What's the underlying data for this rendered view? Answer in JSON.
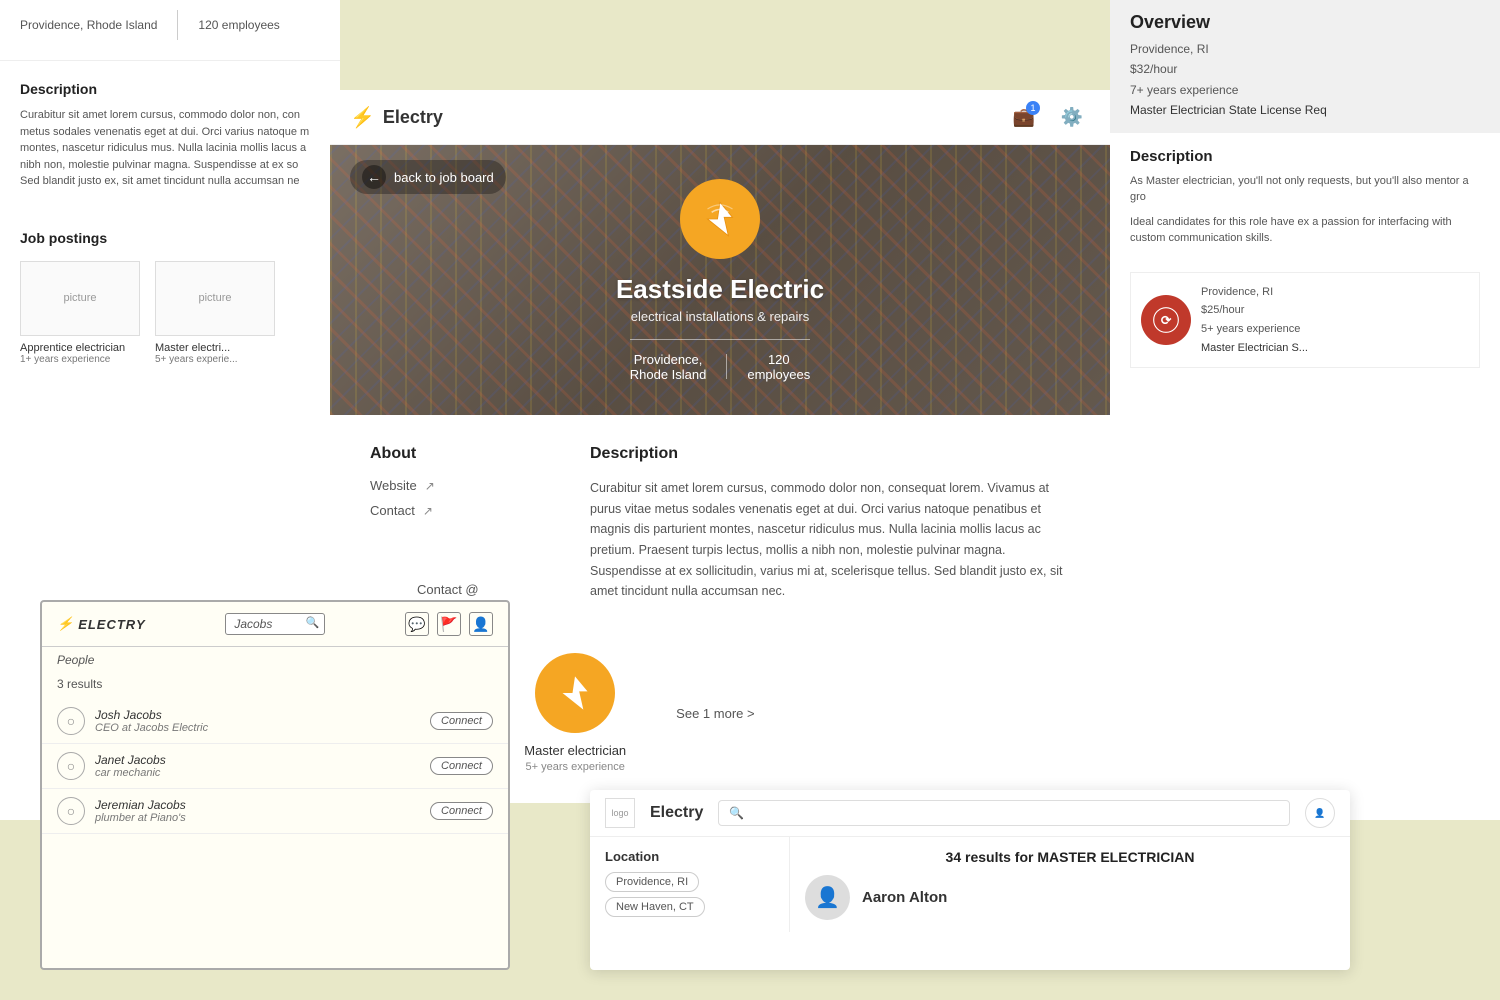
{
  "app": {
    "name": "Electry",
    "logo_symbol": "⚡"
  },
  "header": {
    "title": "Electry",
    "notification_count": "1"
  },
  "back_button": {
    "label": "back to job board"
  },
  "company": {
    "name": "Eastside Electric",
    "tagline": "electrical installations & repairs",
    "location": "Providence,\nRhode Island",
    "employees": "120\nemployees",
    "website_label": "Website",
    "contact_label": "Contact"
  },
  "description": {
    "title": "Description",
    "text": "Curabitur sit amet lorem cursus, commodo dolor non, consequat lorem. Vivamus at purus vitae metus sodales venenatis eget at dui. Orci varius natoque penatibus et magnis dis parturient montes, nascetur ridiculus mus. Nulla lacinia mollis lacus ac pretium. Praesent turpis lectus, mollis a nibh non, molestie pulvinar magna. Suspendisse at ex sollicitudin, varius mi at, scelerisque tellus. Sed blandit justo ex, sit amet tincidunt nulla accumsan nec."
  },
  "about": {
    "title": "About"
  },
  "job_postings": {
    "title": "Job postings",
    "jobs": [
      {
        "title": "Apprentice electrician",
        "experience": "1+ years experience"
      },
      {
        "title": "Master electrician",
        "experience": "5+ years experience"
      }
    ],
    "see_more": "See 1 more >"
  },
  "left_panel": {
    "location": "Providence,\nRhode Island",
    "employees": "120\nemployees",
    "description_title": "Description",
    "description_text": "Curabitur sit amet lorem cursus, commodo dolor non, con metus sodales venenatis eget at dui. Orci varius natoque m montes, nascetur ridiculus mus. Nulla lacinia mollis lacus a nibh non, molestie pulvinar magna. Suspendisse at ex so Sed blandit justo ex, sit amet tincidunt nulla accumsan ne",
    "jobs_title": "Job postings",
    "job1_title": "Apprentice electrician",
    "job1_exp": "1+ years experience",
    "job2_title": "Master electri...",
    "job2_exp": "5+ years experie..."
  },
  "right_panel": {
    "overview_title": "Overview",
    "location": "Providence, RI",
    "rate": "$32/hour",
    "experience": "7+ years experience",
    "license": "Master Electrician State License Req",
    "desc_title": "Description",
    "desc_text1": "As Master electrician, you'll not only requests, but you'll also mentor a gro",
    "desc_text2": "Ideal candidates for this role have ex a passion for interfacing with custom communication skills.",
    "company_location": "Providence, RI",
    "company_rate": "$25/hour",
    "company_exp": "5+ years experience",
    "company_license": "Master Electrician S..."
  },
  "sketch": {
    "logo": "⚡ ELECTRY",
    "search_placeholder": "Jacobs",
    "subtitle": "People",
    "results_count": "3 results",
    "persons": [
      {
        "name": "Josh Jacobs",
        "role": "CEO at Jacobs Electric",
        "button": "Connect"
      },
      {
        "name": "Janet Jacobs",
        "role": "car mechanic",
        "button": "Connect"
      },
      {
        "name": "Jeremian Jacobs",
        "role": "plumber at Piano's",
        "button": "Connect"
      }
    ]
  },
  "search_panel": {
    "app_name": "Electry",
    "logo_placeholder": "logo",
    "profile_placeholder": "profile picture",
    "results_title": "34 results for MASTER ELECTRICIAN",
    "location_title": "Location",
    "locations": [
      "Providence, RI",
      "New Haven, CT"
    ],
    "person_name": "Aaron Alton"
  }
}
